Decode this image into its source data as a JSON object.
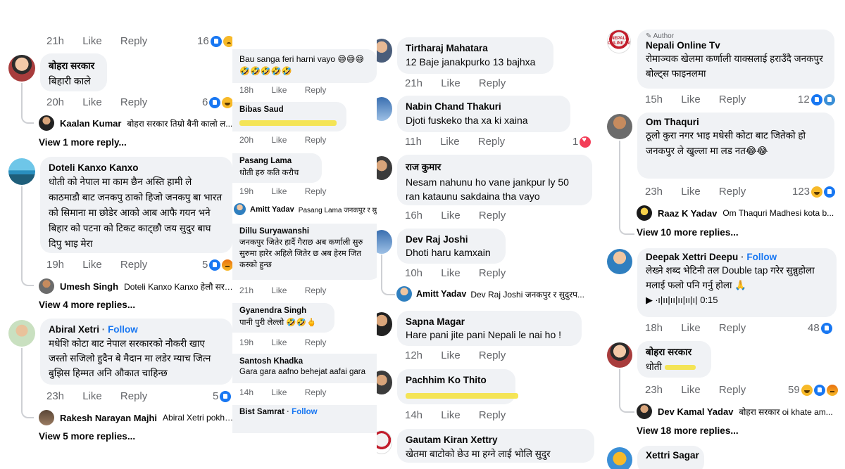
{
  "col1": {
    "top_meta": {
      "time": "21h",
      "like": "Like",
      "reply": "Reply",
      "count": "16"
    },
    "c1": {
      "author": "बोहरा सरकार",
      "text": "बिहारी काले",
      "time": "20h",
      "like": "Like",
      "reply": "Reply",
      "count": "6",
      "sub_name": "Kaalan Kumar",
      "sub_text": "बोहरा सरकार तिम्रो बैनी कालो ल...",
      "more": "View 1 more reply..."
    },
    "c2": {
      "author": "Doteli Kanxo Kanxo",
      "text": "धोती को नेपाल मा काम छैन अस्ति हामी ले काठमाडौ बाट जनकपु ठाको हिजो जनकपु बा भारत को सिमाना मा छोडेर आको आब आफै गयन भने बिहार को पटना को टिकट काट्छौ जय सुदुर बाघ दिपु भाइ मेरा",
      "time": "19h",
      "like": "Like",
      "reply": "Reply",
      "count": "5",
      "sub_name": "Umesh Singh",
      "sub_text": "Doteli Kanxo Kanxo हेलौ सर त...",
      "more": "View 4 more replies..."
    },
    "c3": {
      "author": "Abiral Xetri",
      "follow": "Follow",
      "text": "मधेशि कोटा बाट नेपाल सरकारको नौकरी खाए जस्तो सजिलो हुदैन बे मैदान मा लडेर म्याच जित्न बुझिस हिम्मत अनि औकात चाहिन्छ",
      "time": "23h",
      "like": "Like",
      "reply": "Reply",
      "count": "5",
      "sub_name": "Rakesh Narayan Majhi",
      "sub_text": "Abiral Xetri  pokha...",
      "more": "View 5 more replies..."
    }
  },
  "col2": {
    "c0": {
      "text": "Bau sanga feri harni vayo 😅😅😅🤣🤣🤣🤣🤣",
      "time": "18h",
      "like": "Like",
      "reply": "Reply"
    },
    "c1": {
      "author": "Bibas Saud",
      "time": "20h",
      "like": "Like",
      "reply": "Reply"
    },
    "c2": {
      "author": "Pasang Lama",
      "text": "धोती  हरु  कति  करौच",
      "time": "19h",
      "like": "Like",
      "reply": "Reply"
    },
    "sub1": {
      "name": "Amitt Yadav",
      "text": "Pasang Lama जनकपुर र सु"
    },
    "c3": {
      "author": "Dillu Suryawanshi",
      "text": "जनकपुर जितेर हार्दै गैराछ अब कर्णाली सुरु सुरुमा हारेर अहिले जितेर छ अब हेरम जित कस्को हुन्छ",
      "time": "21h",
      "like": "Like",
      "reply": "Reply"
    },
    "c4": {
      "author": "Gyanendra Singh",
      "text": "पानी पुरी लेल्लो 🤣🤣🖕",
      "time": "19h",
      "like": "Like",
      "reply": "Reply"
    },
    "c5": {
      "author": "Santosh Khadka",
      "text": "Gara gara aafno behejat aafai gara",
      "time": "14h",
      "like": "Like",
      "reply": "Reply"
    },
    "c6": {
      "author": "Bist Samrat",
      "follow": "Follow"
    }
  },
  "col3": {
    "c1": {
      "author": "Tirtharaj Mahatara",
      "text": "12 Baje janakpurko 13 bajhxa",
      "time": "21h",
      "like": "Like",
      "reply": "Reply"
    },
    "c2": {
      "author": "Nabin Chand Thakuri",
      "text": "Djoti fuskeko tha xa ki xaina",
      "time": "11h",
      "like": "Like",
      "reply": "Reply",
      "count": "1"
    },
    "c3": {
      "author": "राज कुमार",
      "text": "Nesam nahunu ho vane jankpur ly 50 ran kataunu sakdaina tha vayo",
      "time": "16h",
      "like": "Like",
      "reply": "Reply"
    },
    "c4": {
      "author": "Dev Raj Joshi",
      "text": "Dhoti haru kamxain",
      "time": "10h",
      "like": "Like",
      "reply": "Reply",
      "sub_name": "Amitt Yadav",
      "sub_text": "Dev Raj Joshi जनकपुर र सुदुरप..."
    },
    "c5": {
      "author": "Sapna Magar",
      "text": "Hare pani jite pani Nepali le nai ho !",
      "time": "12h",
      "like": "Like",
      "reply": "Reply"
    },
    "c6": {
      "author": "Pachhim Ko Thito",
      "time": "14h",
      "like": "Like",
      "reply": "Reply"
    },
    "c7": {
      "author": "Gautam Kiran Xettry",
      "text": "खेतमा बाटोको छेउ मा हग्ने लाई भोलि सुदुर"
    }
  },
  "col4": {
    "c1": {
      "badge": "✎ Author",
      "author": "Nepali Online Tv",
      "text": "रोमाञ्चक खेलमा कर्णाली याक्सलाई हराउँदै जनकपुर बोल्ट्स फाइनलमा",
      "time": "15h",
      "like": "Like",
      "reply": "Reply",
      "count": "12",
      "logo_text": "NEPALI ONLINE TV"
    },
    "c2": {
      "author": "Om Thaquri",
      "text": "ठूलो कुरा नगर भाइ मधेसी कोटा बाट जितेको हो जनकपुर ले खुल्ला मा लड नत😂😂",
      "time": "23h",
      "like": "Like",
      "reply": "Reply",
      "count": "123",
      "sub_name": "Raaz K Yadav",
      "sub_text": "Om Thaquri Madhesi kota b...",
      "more": "View 10 more replies..."
    },
    "c3": {
      "author": "Deepak Xettri Deepu",
      "follow": "Follow",
      "text": "लेख्ने शब्द भेटिनी तल Double tap गरेर सुन्नुहोला मलाई फलो पनि गर्नु होला 🙏",
      "audio": "▶ ∙ı|ıı|ıı|ıı|ıı|ı| 0:15",
      "time": "18h",
      "like": "Like",
      "reply": "Reply",
      "count": "48"
    },
    "c4": {
      "author": "बोहरा सरकार",
      "text": "धोती",
      "time": "23h",
      "like": "Like",
      "reply": "Reply",
      "count": "59",
      "sub_name": "Dev Kamal Yadav",
      "sub_text": "बोहरा सरकार oi khate am...",
      "more": "View 18 more replies..."
    },
    "c5": {
      "author": "Xettri Sagar"
    }
  }
}
